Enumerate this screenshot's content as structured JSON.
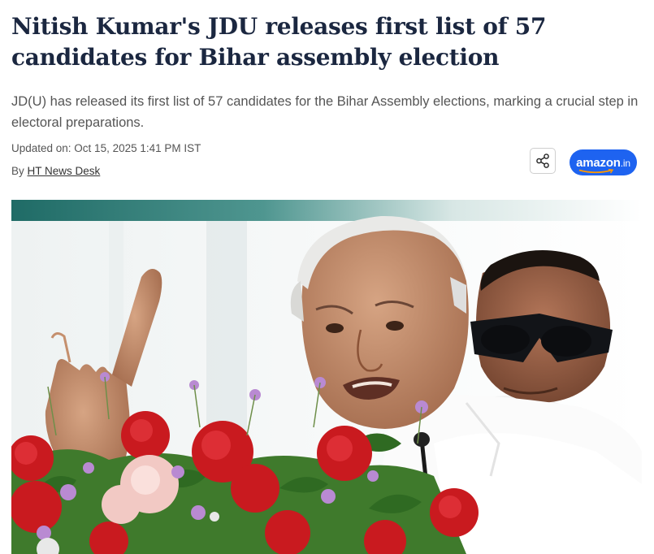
{
  "article": {
    "headline": "Nitish Kumar's JDU releases first list of 57 candidates for Bihar assembly election",
    "summary": "JD(U) has released its first list of 57 candidates for the Bihar Assembly elections, marking a crucial step in electoral preparations.",
    "updated": "Updated on: Oct 15, 2025 1:41 PM IST",
    "byline_prefix": "By",
    "author": "HT News Desk"
  },
  "actions": {
    "share_icon": "share-icon",
    "amazon_label": "amazon",
    "amazon_tld": ".in"
  },
  "colors": {
    "headline": "#1b2740",
    "amazon_button": "#1e63f0",
    "muted_text": "#555555"
  }
}
